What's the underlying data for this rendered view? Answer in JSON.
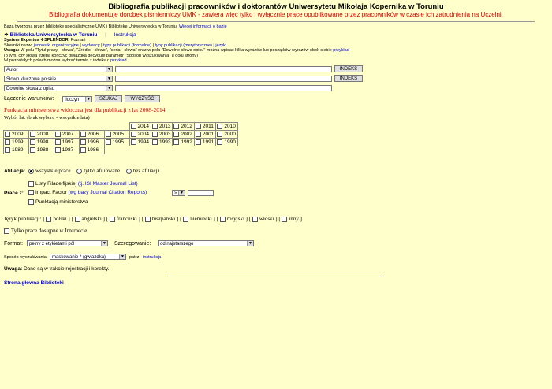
{
  "header": {
    "title": "Bibliografia publikacji pracowników i doktorantów Uniwersytetu Mikołaja Kopernika w Toruniu",
    "subtitle": "Bibliografia dokumentuje dorobek piśmienniczy UMK - zawiera więc tylko i wyłącznie prace opublikowane przez pracowników w czasie ich zatrudnienia na Uczelni."
  },
  "intro": {
    "created_by": "Baza tworzona przez bibliotekę specjalistyczne UMK i Bibliotekę Uniwersytecką w Toruniu.",
    "more_info_link": "Więcej informacji o bazie",
    "library_link": "Biblioteka Uniwersytecka w Toruniu",
    "instruction_link": "Instrukcja",
    "system_label": "System Expertus",
    "splendor": "SPLENDOR",
    "city": ", Poznań",
    "dictionaries_label": "Słowniki nazw:",
    "dict_links": [
      "jednostki organizacyjne",
      "wydawcy",
      "typy publikacji (formalne)",
      "typy publikacji (merytoryczne)",
      "języki"
    ],
    "note_label": "Uwaga:",
    "note_line1": "W polu \"Tytuł pracy - słowa\", \"Źródło - słowo\", \"seria - słowa\" oraz w polu \"Dowolne słowa opisu\" można wpisać kilka wyrazów lub początków wyrazów obok siebie",
    "example_link": "przykład",
    "note_line2": "(o tym, czy słowa trzeba kończyć gwiazdką decyduje parametr \"Sposób wyszukiwania\" u dołu strony)",
    "note_line3": "W pozostałych polach można wybrać termin z indeksu:"
  },
  "search": {
    "fields": [
      "Autor",
      "Słowo kluczowe polskie",
      "Dowolne słowa z opisu"
    ],
    "index_button": "INDEKS",
    "conditions_label": "Łączenie warunków:",
    "conditions_value": "iloczyn",
    "search_button": "SZUKAJ",
    "clear_button": "WYCZYŚĆ"
  },
  "points_note": "Punktacja ministerstwa widoczna jest dla publikacji z lat 2008-2014",
  "years": {
    "label": "Wybór lat: (brak wyboru - wszystkie lata)",
    "row1": [
      "2014",
      "2013",
      "2012",
      "2011",
      "2010"
    ],
    "row2": [
      "2009",
      "2008",
      "2007",
      "2006",
      "2005",
      "2004",
      "2003",
      "2002",
      "2001",
      "2000"
    ],
    "row3": [
      "1999",
      "1998",
      "1997",
      "1996",
      "1995",
      "1994",
      "1993",
      "1992",
      "1991",
      "1990"
    ],
    "row4": [
      "1989",
      "1988",
      "1987",
      "1986"
    ]
  },
  "affiliation": {
    "label": "Afiliacja:",
    "options": [
      "wszystkie prace",
      "tylko afiliowane",
      "bez afiliacji"
    ]
  },
  "works": {
    "label": "Prace z:",
    "philadelphia": "Listy Filadelfijskiej",
    "philadelphia_link": "(tj. ISI Master Journal List)",
    "impact": "Impact Factor",
    "impact_link": "(wg bazy Journal Citation Reports)",
    "impact_op": "≥",
    "points": "Punktacją ministerstwa"
  },
  "languages": {
    "label": "Język publikacji:",
    "items": [
      "polski",
      "angielski",
      "francuski",
      "hiszpański",
      "niemiecki",
      "rosyjski",
      "włoski",
      "inny"
    ]
  },
  "internet_only": "Tylko prace dostępne w Internecie",
  "format": {
    "label": "Format:",
    "value": "pełny z etykietami pól"
  },
  "sort": {
    "label": "Szeregowanie:",
    "value": "od najstarszego"
  },
  "method": {
    "label": "Sposób wyszukiwania",
    "value": "maskowanie * (gwiazdka)",
    "see": "patrz -",
    "link": "instrukcja"
  },
  "remark": {
    "label": "Uwaga:",
    "text": "Dane są w trakcie rejestracji i korekty."
  },
  "footer_link": "Strona główna Biblioteki"
}
